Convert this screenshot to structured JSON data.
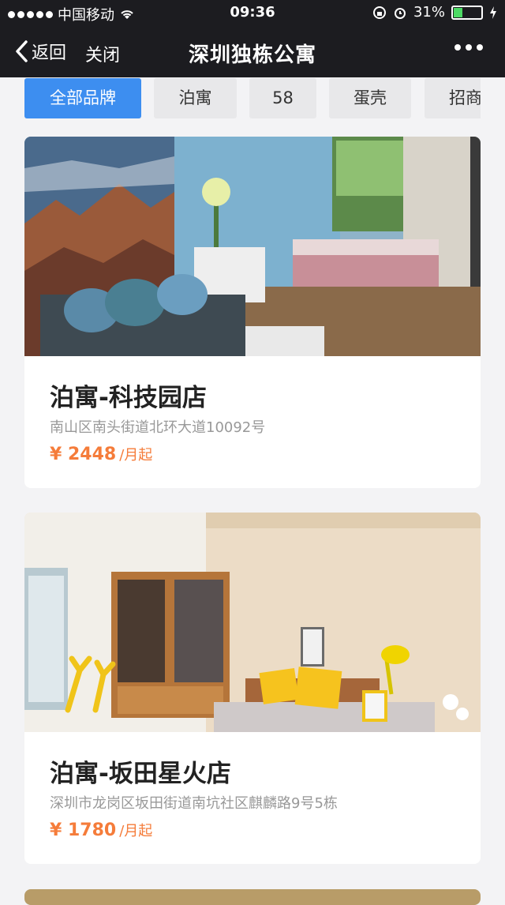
{
  "status": {
    "carrier": "中国移动",
    "time": "09:36",
    "battery": "31%"
  },
  "nav": {
    "back": "返回",
    "close": "关闭",
    "title": "深圳独栋公寓"
  },
  "tabs": [
    "全部品牌",
    "泊寓",
    "58",
    "蛋壳",
    "招商"
  ],
  "listings": [
    {
      "name": "泊寓-科技园店",
      "address": "南山区南头街道北环大道10092号",
      "price": "¥ 2448",
      "unit": "/月起"
    },
    {
      "name": "泊寓-坂田星火店",
      "address": "深圳市龙岗区坂田街道南坑社区麒麟路9号5栋",
      "price": "¥ 1780",
      "unit": "/月起"
    }
  ],
  "colors": {
    "accent": "#3d8ef0",
    "price": "#f57c3a",
    "nav_bg": "#1c1c20"
  }
}
